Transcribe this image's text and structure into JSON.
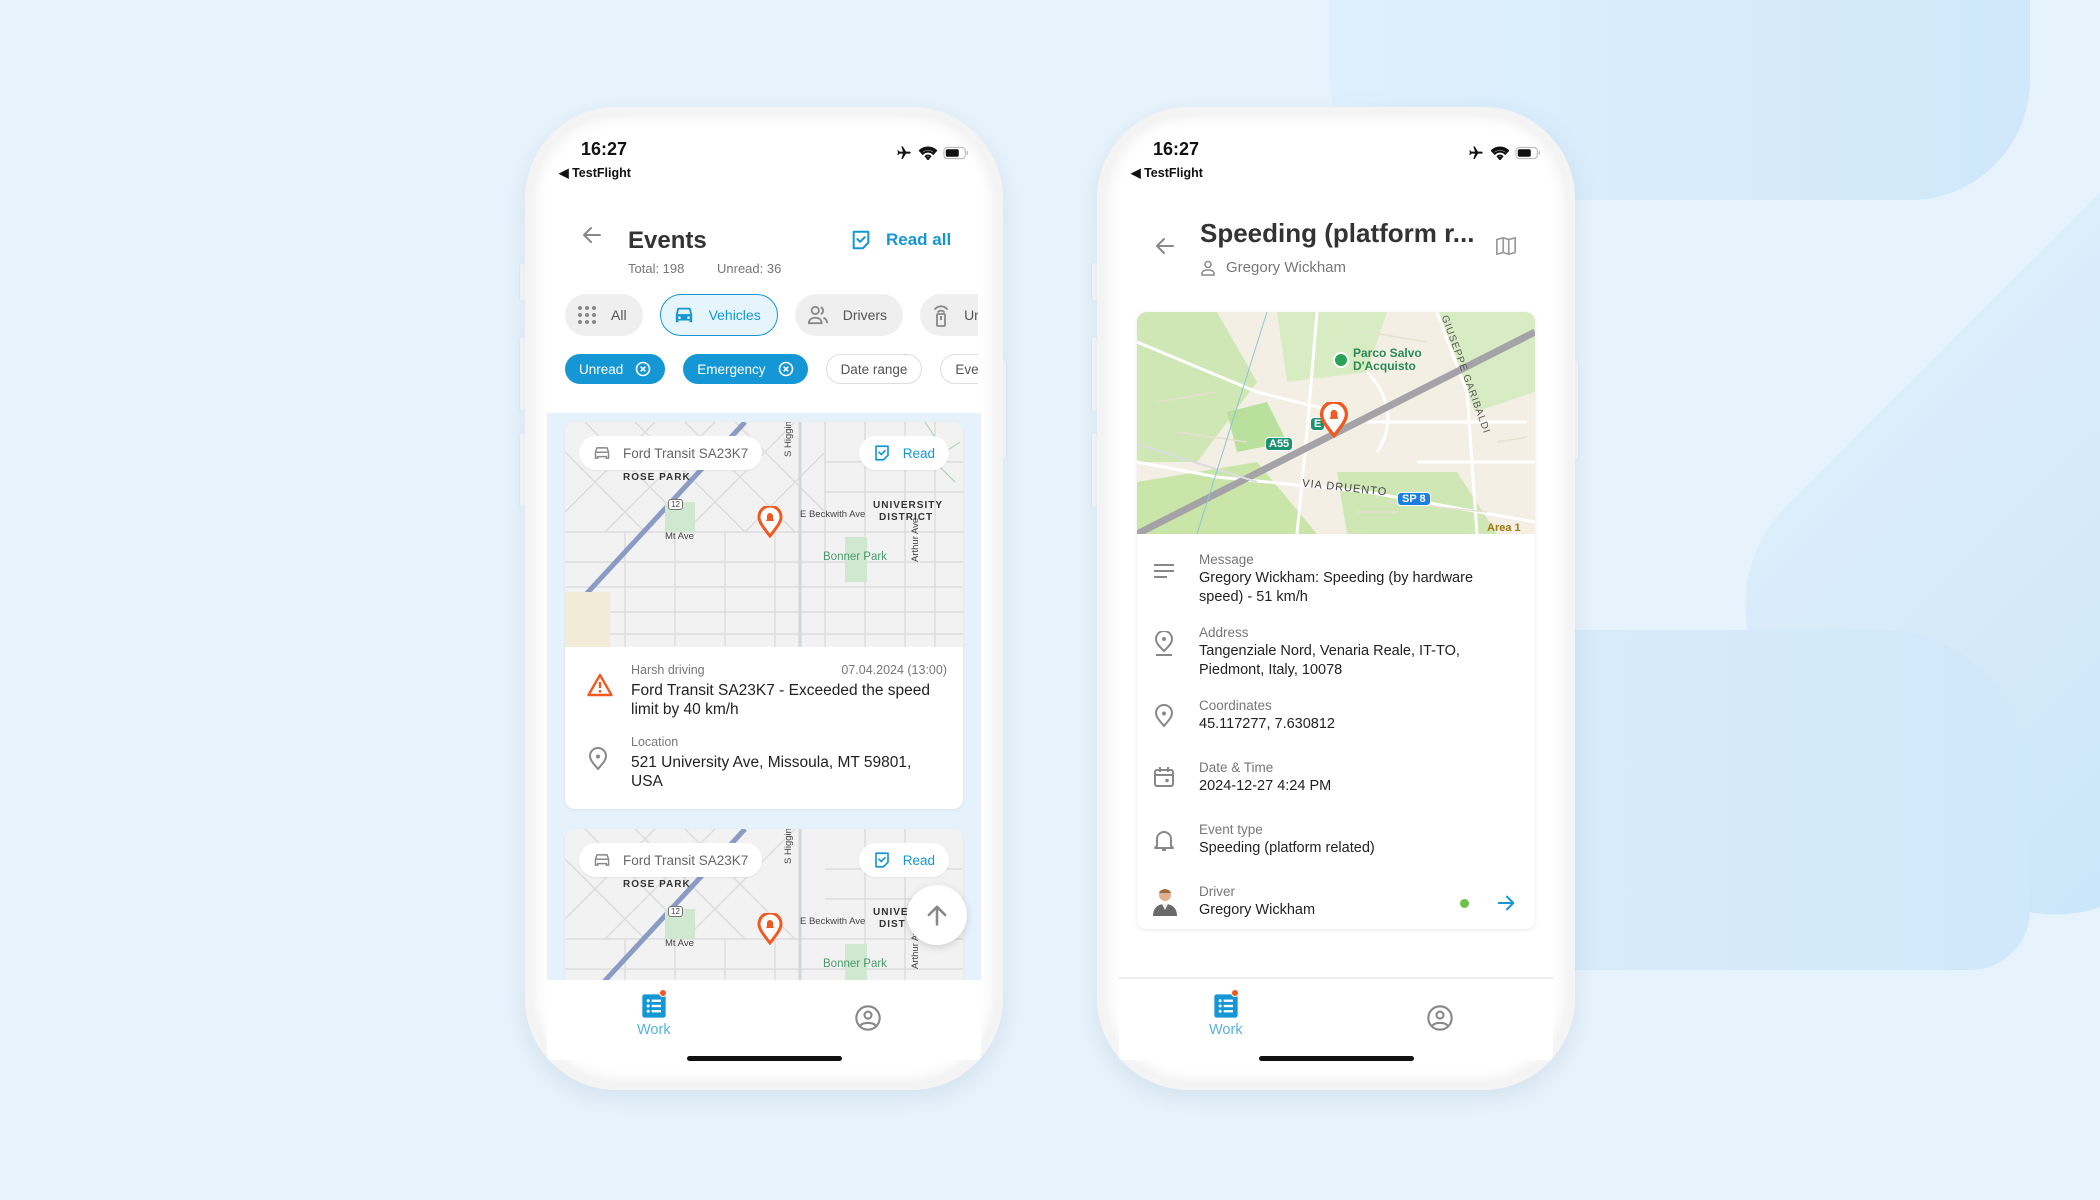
{
  "status_bar": {
    "time": "16:27",
    "back_app": "◀ TestFlight"
  },
  "events_screen": {
    "title": "Events",
    "total_label": "Total: 198",
    "unread_label": "Unread: 36",
    "read_all_label": "Read all",
    "category_chips": [
      {
        "label": "All",
        "icon": "grid-icon",
        "active": false
      },
      {
        "label": "Vehicles",
        "icon": "car-icon",
        "active": true
      },
      {
        "label": "Drivers",
        "icon": "users-icon",
        "active": false
      },
      {
        "label": "Un",
        "icon": "tracker-icon",
        "active": false
      }
    ],
    "filter_chips": [
      {
        "label": "Unread",
        "active": true
      },
      {
        "label": "Emergency",
        "active": true
      },
      {
        "label": "Date range",
        "active": false
      },
      {
        "label": "Event t",
        "active": false
      }
    ],
    "cards": [
      {
        "vehicle": "Ford Transit SA23K7",
        "read_label": "Read",
        "map_labels": {
          "area1": "ROSE PARK",
          "route": "12",
          "street1": "Mt Ave",
          "street2": "E Beckwith Ave",
          "street3": "S Higgins Ave",
          "street4": "Arthur Ave",
          "district": "UNIVERSITY",
          "district2": "DISTRICT",
          "park": "Bonner Park"
        },
        "category": "Harsh driving",
        "date": "07.04.2024 (13:00)",
        "description": "Ford Transit SA23K7 - Exceeded the speed limit by 40 km/h",
        "location_label": "Location",
        "location": "521 University Ave, Missoula, MT 59801, USA"
      },
      {
        "vehicle": "Ford Transit SA23K7",
        "read_label": "Read",
        "map_labels": {
          "area1": "ROSE PARK",
          "route": "12",
          "street1": "Mt Ave",
          "street2": "E Beckwith Ave",
          "street3": "S Higgins Ave",
          "street4": "Arthur Ave",
          "district": "UNIVER",
          "district2": "DIST",
          "park": "Bonner Park"
        }
      }
    ]
  },
  "detail_screen": {
    "title": "Speeding (platform r...",
    "driver_subtitle": "Gregory Wickham",
    "map_labels": {
      "park": "Parco Salvo",
      "park2": "D'Acquisto",
      "road": "GIUSEPPE GARIBALDI",
      "street": "VIA DRUENTO",
      "shield_a55": "A55",
      "shield_sp8": "SP 8",
      "shield_e": "E",
      "area": "Area 1"
    },
    "fields": [
      {
        "icon": "message-lines-icon",
        "label": "Message",
        "value": "Gregory Wickham: Speeding (by hardware speed) - 51 km/h"
      },
      {
        "icon": "address-pin-icon",
        "label": "Address",
        "value": "Tangenziale Nord, Venaria Reale, IT-TO, Piedmont, Italy, 10078"
      },
      {
        "icon": "location-pin-icon",
        "label": "Coordinates",
        "value": "45.117277, 7.630812"
      },
      {
        "icon": "calendar-icon",
        "label": "Date & Time",
        "value": "2024-12-27 4:24 PM"
      },
      {
        "icon": "bell-icon",
        "label": "Event type",
        "value": "Speeding (platform related)"
      },
      {
        "icon": "avatar",
        "label": "Driver",
        "value": "Gregory Wickham",
        "online": true
      }
    ]
  },
  "tab_bar": {
    "work_label": "Work"
  },
  "colors": {
    "accent": "#1597d6",
    "alert": "#f05a22",
    "online": "#6cc24a",
    "background": "#e7f3fc"
  }
}
